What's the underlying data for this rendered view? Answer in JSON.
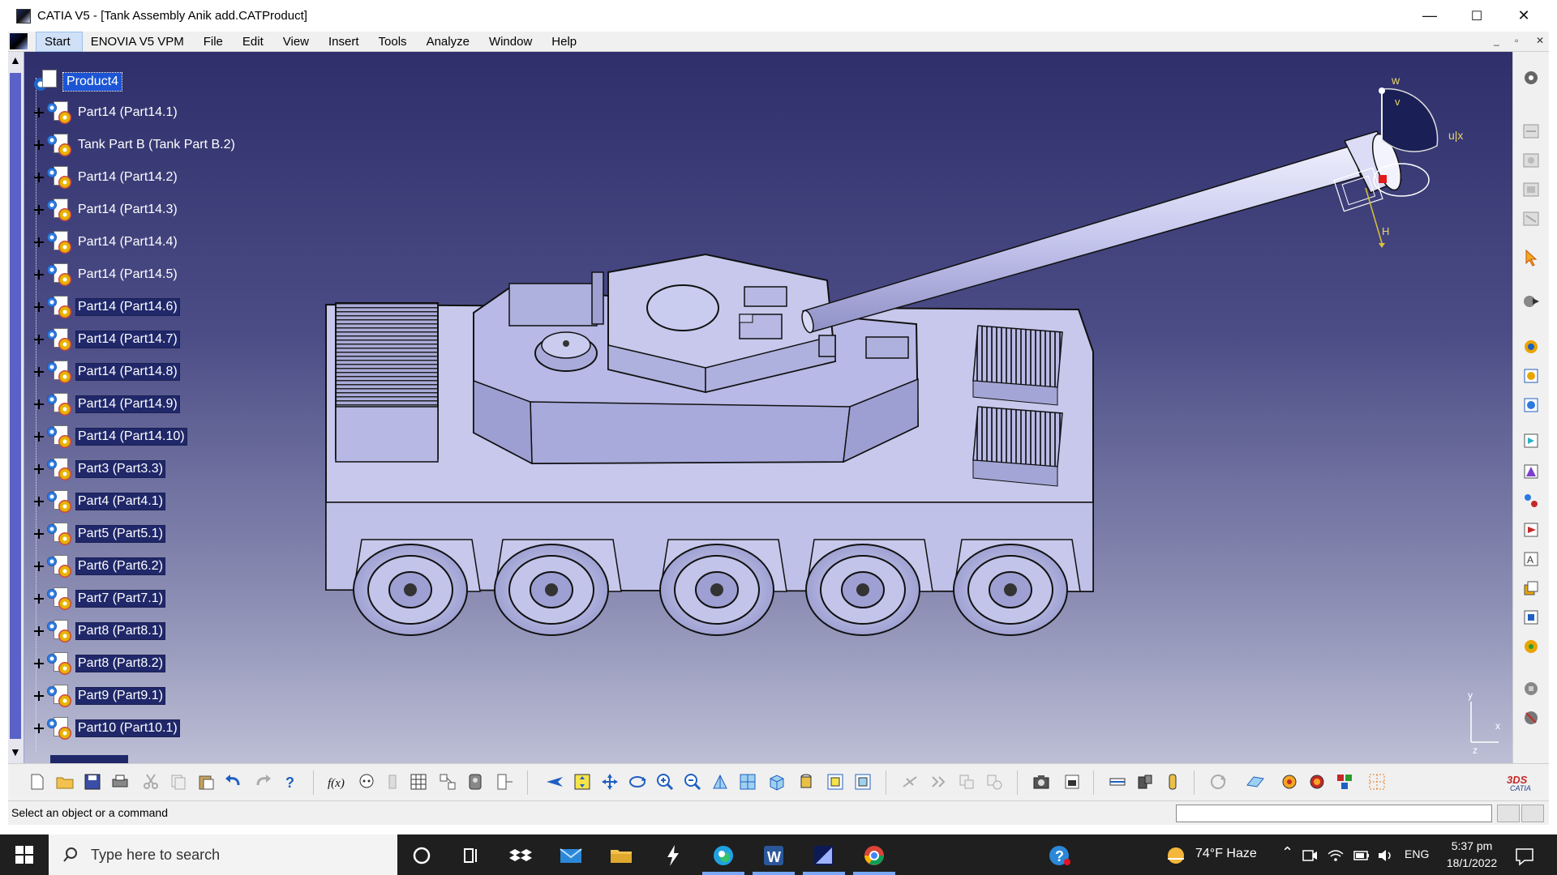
{
  "window": {
    "title": "CATIA V5 - [Tank Assembly Anik add.CATProduct]",
    "minimize": "—",
    "maximize": "☐",
    "close": "✕"
  },
  "menu": {
    "items": [
      "Start",
      "ENOVIA V5 VPM",
      "File",
      "Edit",
      "View",
      "Insert",
      "Tools",
      "Analyze",
      "Window",
      "Help"
    ],
    "doc_minimize": "_",
    "doc_restore": "▫",
    "doc_close": "✕"
  },
  "tree": {
    "root": "Product4",
    "items": [
      "Part14 (Part14.1)",
      "Tank Part B (Tank Part B.2)",
      "Part14 (Part14.2)",
      "Part14 (Part14.3)",
      "Part14 (Part14.4)",
      "Part14 (Part14.5)",
      "Part14 (Part14.6)",
      "Part14 (Part14.7)",
      "Part14 (Part14.8)",
      "Part14 (Part14.9)",
      "Part14 (Part14.10)",
      "Part3 (Part3.3)",
      "Part4 (Part4.1)",
      "Part5 (Part5.1)",
      "Part6 (Part6.2)",
      "Part7 (Part7.1)",
      "Part8 (Part8.1)",
      "Part8 (Part8.2)",
      "Part9 (Part9.1)",
      "Part10 (Part10.1)"
    ]
  },
  "compass": {
    "w": "w",
    "v": "v",
    "u_x": "u|x",
    "h": "H"
  },
  "axis": {
    "x": "x",
    "y": "y",
    "z": "z"
  },
  "status": {
    "text": "Select an object or a command"
  },
  "taskbar": {
    "search_placeholder": "Type here to search",
    "weather": "74°F  Haze",
    "language": "ENG",
    "time": "5:37 pm",
    "date": "18/1/2022"
  },
  "colors": {
    "viewport_top": "#2e2f6b",
    "viewport_bottom": "#bdbfd6",
    "tank_body": "#c7c8ec",
    "tree_selection": "#1b55d6"
  }
}
